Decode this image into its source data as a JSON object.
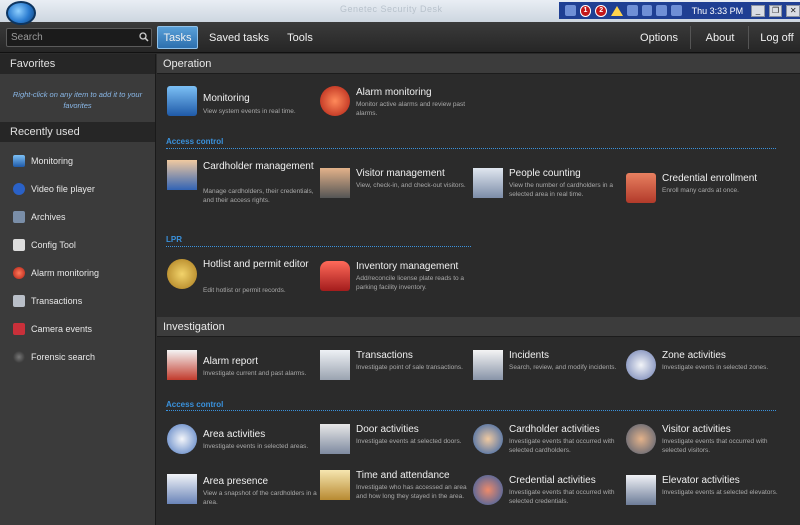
{
  "titlebar": {
    "faded_title": "Genetec Security Desk",
    "badges": [
      "1",
      "2"
    ],
    "clock": "Thu 3:33 PM",
    "window_buttons": [
      "_",
      "❐",
      "✕"
    ]
  },
  "toolbar": {
    "search_placeholder": "Search",
    "tabs": [
      "Tasks",
      "Saved tasks",
      "Tools"
    ],
    "right": [
      "Options",
      "About",
      "Log off"
    ]
  },
  "sidebar": {
    "favorites_title": "Favorites",
    "favorites_hint": "Right-click on any item to add it to your favorites",
    "recent_title": "Recently used",
    "recent_items": [
      "Monitoring",
      "Video file player",
      "Archives",
      "Config Tool",
      "Alarm monitoring",
      "Transactions",
      "Camera events",
      "Forensic search"
    ]
  },
  "main": {
    "operation": {
      "title": "Operation",
      "monitoring": {
        "title": "Monitoring",
        "desc": "View system events in real time."
      },
      "alarm_monitoring": {
        "title": "Alarm monitoring",
        "desc": "Monitor active alarms and review past alarms."
      },
      "access_control_label": "Access control",
      "cardholder_management": {
        "title": "Cardholder management",
        "desc": "Manage cardholders, their credentials, and their access rights."
      },
      "visitor_management": {
        "title": "Visitor management",
        "desc": "View, check-in, and check-out visitors."
      },
      "people_counting": {
        "title": "People counting",
        "desc": "View the number of cardholders in a selected area in real time."
      },
      "credential_enrollment": {
        "title": "Credential enrollment",
        "desc": "Enroll many cards at once."
      },
      "lpr_label": "LPR",
      "hotlist": {
        "title": "Hotlist and permit editor",
        "desc": "Edit hotlist or permit records."
      },
      "inventory_management": {
        "title": "Inventory management",
        "desc": "Add/reconcile license plate reads to a parking facility inventory."
      }
    },
    "investigation": {
      "title": "Investigation",
      "alarm_report": {
        "title": "Alarm report",
        "desc": "Investigate current and past alarms."
      },
      "transactions": {
        "title": "Transactions",
        "desc": "Investigate point of sale transactions."
      },
      "incidents": {
        "title": "Incidents",
        "desc": "Search, review, and modify incidents."
      },
      "zone_activities": {
        "title": "Zone activities",
        "desc": "Investigate events in selected zones."
      },
      "access_control_label": "Access control",
      "area_activities": {
        "title": "Area activities",
        "desc": "Investigate events in selected areas."
      },
      "door_activities": {
        "title": "Door activities",
        "desc": "Investigate events at selected doors."
      },
      "cardholder_activities": {
        "title": "Cardholder activities",
        "desc": "Investigate events that occurred with selected cardholders."
      },
      "visitor_activities": {
        "title": "Visitor activities",
        "desc": "Investigate events that occurred with selected visitors."
      },
      "area_presence": {
        "title": "Area presence",
        "desc": "View a snapshot of the cardholders in a area."
      },
      "time_attendance": {
        "title": "Time and attendance",
        "desc": "Investigate who has accessed an area and how long they stayed in the area."
      },
      "credential_activities": {
        "title": "Credential activities",
        "desc": "Investigate events that occurred with selected credentials."
      },
      "elevator_activities": {
        "title": "Elevator activities",
        "desc": "Investigate events at selected elevators."
      }
    }
  }
}
